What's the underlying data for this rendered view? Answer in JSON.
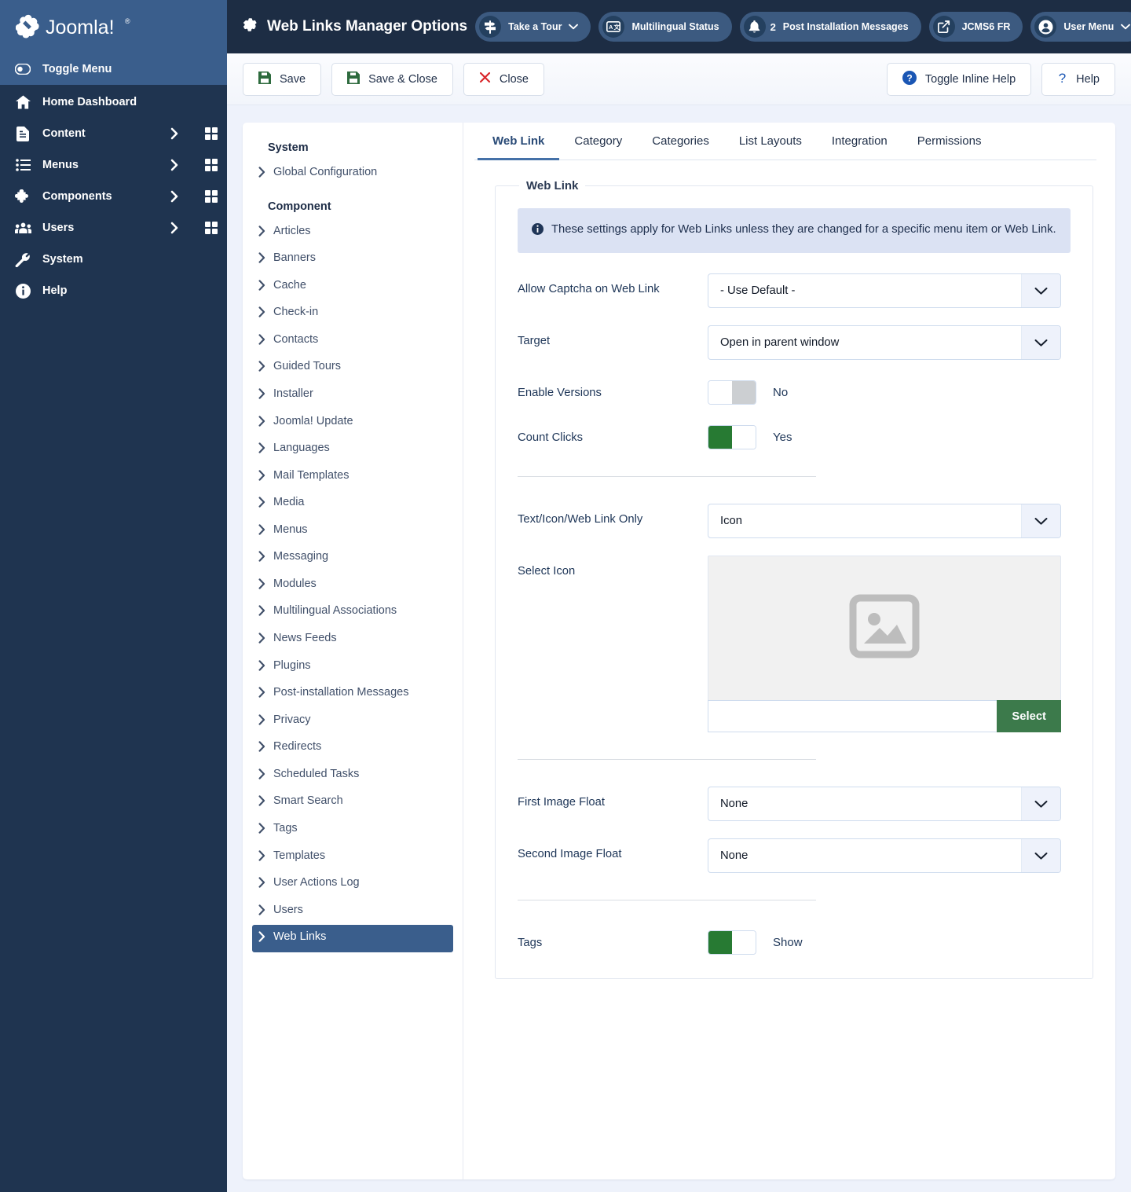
{
  "brand": {
    "name": "Joomla!"
  },
  "sidebar": {
    "toggle_label": "Toggle Menu",
    "items": [
      {
        "label": "Home Dashboard",
        "icon": "home-icon",
        "chevron": false,
        "grid": false
      },
      {
        "label": "Content",
        "icon": "document-icon",
        "chevron": true,
        "grid": true
      },
      {
        "label": "Menus",
        "icon": "list-icon",
        "chevron": true,
        "grid": true
      },
      {
        "label": "Components",
        "icon": "puzzle-icon",
        "chevron": true,
        "grid": true
      },
      {
        "label": "Users",
        "icon": "users-icon",
        "chevron": true,
        "grid": true
      },
      {
        "label": "System",
        "icon": "wrench-icon",
        "chevron": false,
        "grid": false
      },
      {
        "label": "Help",
        "icon": "info-icon",
        "chevron": false,
        "grid": false
      }
    ]
  },
  "header": {
    "title": "Web Links Manager Options",
    "title_icon": "gear-icon",
    "pills": [
      {
        "label": "Take a Tour",
        "icon": "signpost-icon",
        "caret": true,
        "count": ""
      },
      {
        "label": "Multilingual Status",
        "icon": "translate-icon",
        "caret": false,
        "count": ""
      },
      {
        "label": "Post Installation Messages",
        "icon": "bell-icon",
        "caret": false,
        "count": "2"
      },
      {
        "label": "JCMS6 FR",
        "icon": "external-link-icon",
        "caret": false,
        "count": ""
      },
      {
        "label": "User Menu",
        "icon": "user-circle-icon",
        "caret": true,
        "count": ""
      }
    ],
    "overflow": "•••"
  },
  "toolbar": {
    "save": "Save",
    "save_close": "Save & Close",
    "close": "Close",
    "toggle_inline_help": "Toggle Inline Help",
    "help": "Help"
  },
  "listpanel": {
    "system_heading": "System",
    "system_items": [
      "Global Configuration"
    ],
    "component_heading": "Component",
    "component_items": [
      "Articles",
      "Banners",
      "Cache",
      "Check-in",
      "Contacts",
      "Guided Tours",
      "Installer",
      "Joomla! Update",
      "Languages",
      "Mail Templates",
      "Media",
      "Menus",
      "Messaging",
      "Modules",
      "Multilingual Associations",
      "News Feeds",
      "Plugins",
      "Post-installation Messages",
      "Privacy",
      "Redirects",
      "Scheduled Tasks",
      "Smart Search",
      "Tags",
      "Templates",
      "User Actions Log",
      "Users",
      "Web Links"
    ],
    "active_item": "Web Links"
  },
  "tabs": [
    {
      "label": "Web Link",
      "active": true
    },
    {
      "label": "Category",
      "active": false
    },
    {
      "label": "Categories",
      "active": false
    },
    {
      "label": "List Layouts",
      "active": false
    },
    {
      "label": "Integration",
      "active": false
    },
    {
      "label": "Permissions",
      "active": false
    }
  ],
  "form": {
    "legend": "Web Link",
    "alert": "These settings apply for Web Links unless they are changed for a specific menu item or Web Link.",
    "fields": {
      "captcha_label": "Allow Captcha on Web Link",
      "captcha_value": "- Use Default -",
      "target_label": "Target",
      "target_value": "Open in parent window",
      "enable_versions_label": "Enable Versions",
      "enable_versions_state": "No",
      "count_clicks_label": "Count Clicks",
      "count_clicks_state": "Yes",
      "text_icon_label": "Text/Icon/Web Link Only",
      "text_icon_value": "Icon",
      "select_icon_label": "Select Icon",
      "select_icon_input_value": "",
      "select_icon_button": "Select",
      "first_float_label": "First Image Float",
      "first_float_value": "None",
      "second_float_label": "Second Image Float",
      "second_float_value": "None",
      "tags_label": "Tags",
      "tags_state": "Show"
    }
  },
  "colors": {
    "sidebar_bg": "#1f3450",
    "header_bg": "#1d2d44",
    "brand_bg": "#3a5e8c",
    "accent": "#4571a8",
    "toggle_on": "#277a33",
    "select_button": "#3c7a4b",
    "page_bg": "#eef2fb"
  }
}
